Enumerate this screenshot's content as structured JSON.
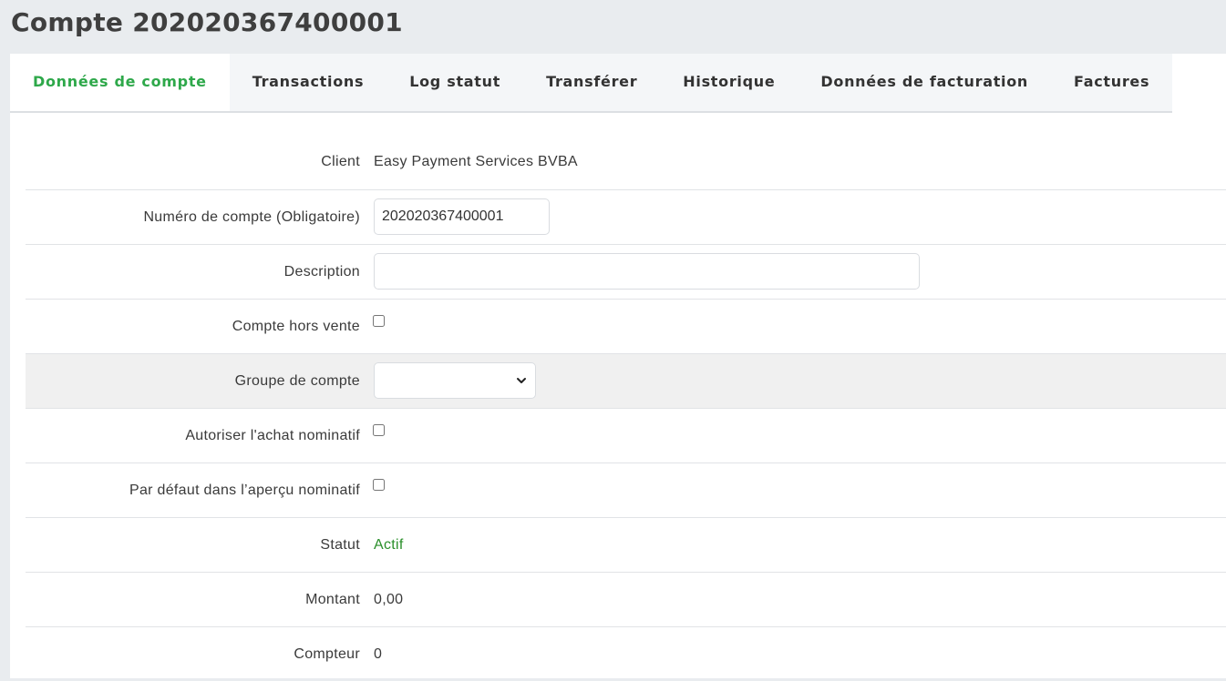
{
  "page": {
    "title": "Compte 202020367400001"
  },
  "tabs": [
    {
      "label": "Données de compte",
      "active": true
    },
    {
      "label": "Transactions"
    },
    {
      "label": "Log statut"
    },
    {
      "label": "Transférer"
    },
    {
      "label": "Historique"
    },
    {
      "label": "Données de facturation"
    },
    {
      "label": "Factures"
    }
  ],
  "form": {
    "client": {
      "label": "Client",
      "value": "Easy Payment Services BVBA"
    },
    "account_number": {
      "label": "Numéro de compte (Obligatoire)",
      "value": "202020367400001"
    },
    "description": {
      "label": "Description",
      "value": ""
    },
    "not_for_sale": {
      "label": "Compte hors vente",
      "checked": false
    },
    "account_group": {
      "label": "Groupe de compte",
      "selected": ""
    },
    "allow_nominative": {
      "label": "Autoriser l'achat nominatif",
      "checked": false
    },
    "default_nominative": {
      "label": "Par défaut dans l’aperçu nominatif",
      "checked": false
    },
    "status": {
      "label": "Statut",
      "value": "Actif"
    },
    "amount": {
      "label": "Montant",
      "value": "0,00"
    },
    "counter": {
      "label": "Compteur",
      "value": "0"
    }
  },
  "colors": {
    "accent": "#2ea84a",
    "status_active": "#2a8f2a",
    "background": "#e9ecef"
  }
}
